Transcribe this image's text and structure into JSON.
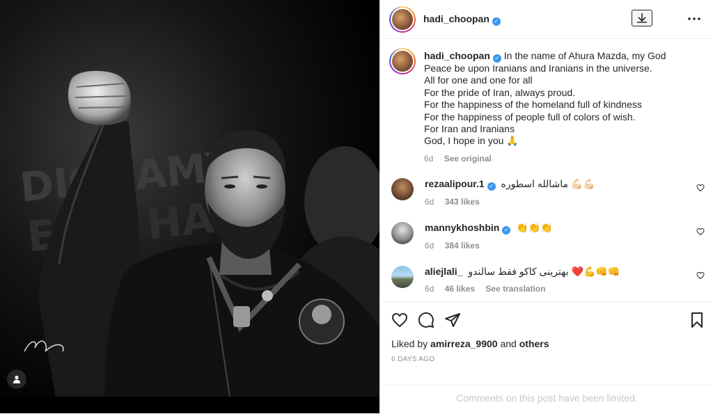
{
  "media": {
    "image_alt": "Black and white photo of a bearded man raising his fist",
    "user_tag_icon": "user-icon"
  },
  "header": {
    "username": "hadi_choopan",
    "download_icon": "download-icon",
    "more_icon": "more-icon"
  },
  "caption": {
    "username": "hadi_choopan",
    "lines": [
      "In the name of Ahura Mazda, my God",
      "Peace be upon Iranians and Iranians in the universe.",
      "All for one and one for all",
      "For the pride of Iran, always proud.",
      "For the happiness of the homeland full of kindness",
      "For the happiness of people full of colors of wish.",
      "For Iran and Iranians",
      "God, I hope in you 🙏"
    ],
    "time": "6d",
    "see_original": "See original"
  },
  "comments": [
    {
      "username": "rezaalipour.1",
      "verified": true,
      "text": "ماشالله اسطوره 💪🏻💪🏻",
      "time": "6d",
      "likes": "343 likes",
      "extra": ""
    },
    {
      "username": "mannykhoshbin",
      "verified": true,
      "text": "👏👏👏",
      "time": "6d",
      "likes": "384 likes",
      "extra": ""
    },
    {
      "username": "aliejlali_",
      "verified": false,
      "text": "بهترینی کاکو فقط سالندو ❤️💪👊👊",
      "time": "6d",
      "likes": "46 likes",
      "extra": "See translation"
    }
  ],
  "actions": {
    "like_icon": "heart-icon",
    "comment_icon": "comment-icon",
    "share_icon": "share-icon",
    "save_icon": "bookmark-icon"
  },
  "liked_by": {
    "prefix": "Liked by",
    "user": "amirreza_9900",
    "joiner": "and",
    "others": "others"
  },
  "posted": "6 DAYS AGO",
  "comments_limited": "Comments on this post have been limited."
}
